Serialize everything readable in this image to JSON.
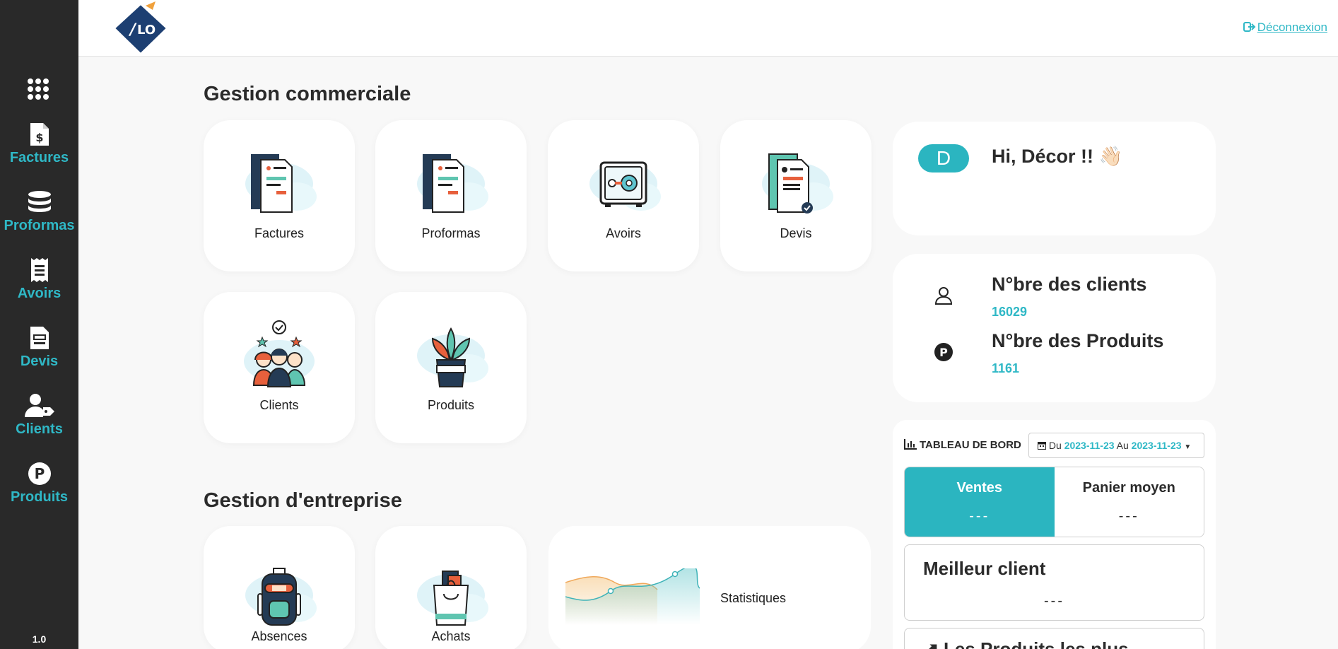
{
  "sidebar": {
    "items": [
      {
        "label": "Factures"
      },
      {
        "label": "Proformas"
      },
      {
        "label": "Avoirs"
      },
      {
        "label": "Devis"
      },
      {
        "label": "Clients"
      },
      {
        "label": "Produits"
      }
    ],
    "version": "1.0"
  },
  "header": {
    "logo_text": "LO",
    "logout_label": "Déconnexion"
  },
  "gestion_commerciale": {
    "title": "Gestion commerciale",
    "tiles": [
      {
        "label": "Factures"
      },
      {
        "label": "Proformas"
      },
      {
        "label": "Avoirs"
      },
      {
        "label": "Devis"
      },
      {
        "label": "Clients"
      },
      {
        "label": "Produits"
      }
    ]
  },
  "gestion_entreprise": {
    "title": "Gestion d'entreprise",
    "tiles": [
      {
        "label": "Absences"
      },
      {
        "label": "Achats"
      },
      {
        "label": "Statistiques"
      }
    ]
  },
  "greeting": {
    "avatar_letter": "D",
    "text": "Hi, Décor !! 👋🏻"
  },
  "counts": {
    "clients_label": "N°bre des clients",
    "clients_value": "16029",
    "products_label": "N°bre des Produits",
    "products_value": "1161"
  },
  "dashboard": {
    "title": "TABLEAU DE BORD",
    "date_prefix": "Du",
    "date_from": "2023-11-23",
    "date_mid": "Au",
    "date_to": "2023-11-23",
    "ventes_label": "Ventes",
    "ventes_value": "---",
    "panier_label": "Panier moyen",
    "panier_value": "---",
    "meilleur_label": "Meilleur client",
    "meilleur_value": "---",
    "produits_label": "Les Produits les plus"
  },
  "colors": {
    "accent": "#2fb8c6",
    "sidebar_bg": "#292929",
    "navy": "#1d3f72"
  }
}
